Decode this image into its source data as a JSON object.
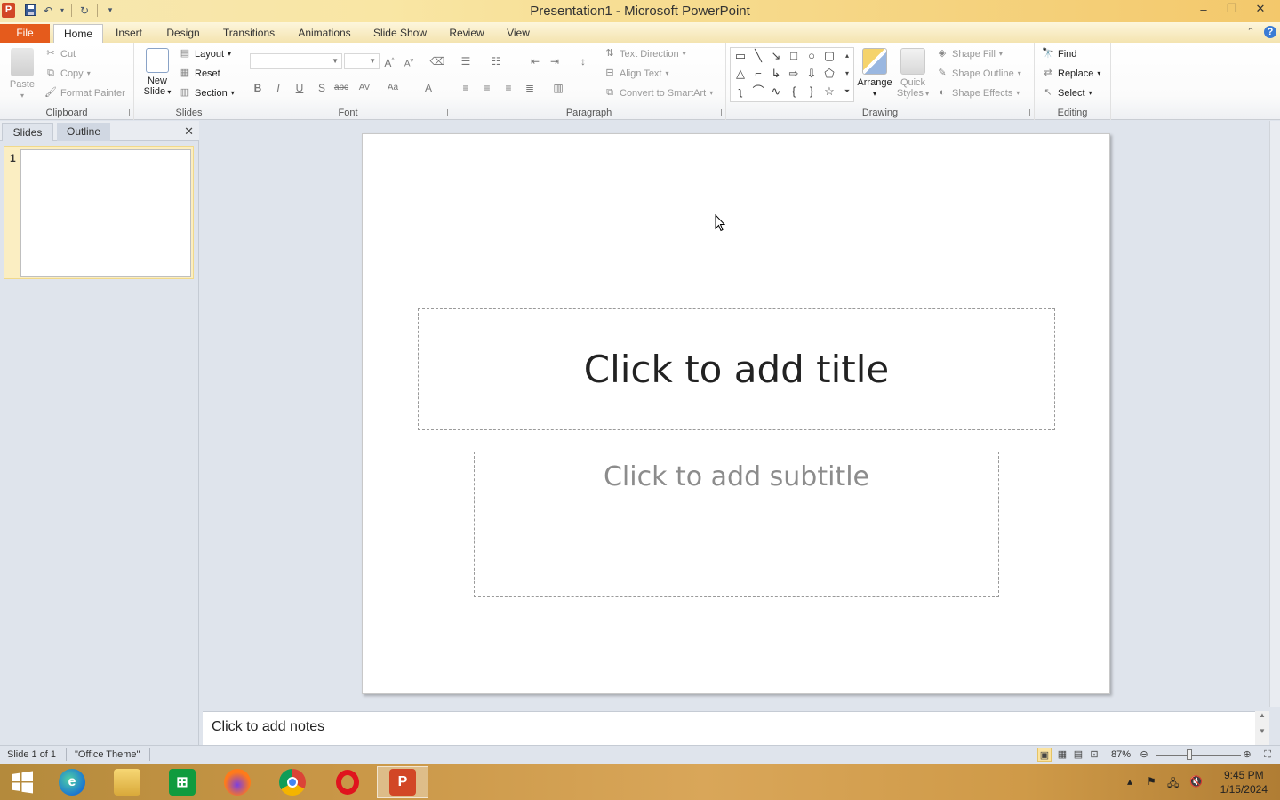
{
  "window": {
    "title": "Presentation1  -  Microsoft PowerPoint",
    "app_icon": "P"
  },
  "tabs": {
    "file": "File",
    "items": [
      "Home",
      "Insert",
      "Design",
      "Transitions",
      "Animations",
      "Slide Show",
      "Review",
      "View"
    ],
    "active": "Home"
  },
  "ribbon": {
    "clipboard": {
      "label": "Clipboard",
      "paste": "Paste",
      "cut": "Cut",
      "copy": "Copy",
      "format_painter": "Format Painter"
    },
    "slides": {
      "label": "Slides",
      "new_slide_line1": "New",
      "new_slide_line2": "Slide",
      "layout": "Layout",
      "reset": "Reset",
      "section": "Section"
    },
    "font": {
      "label": "Font"
    },
    "paragraph": {
      "label": "Paragraph",
      "text_direction": "Text Direction",
      "align_text": "Align Text",
      "convert_smartart": "Convert to SmartArt"
    },
    "drawing": {
      "label": "Drawing",
      "arrange": "Arrange",
      "quick_styles_line1": "Quick",
      "quick_styles_line2": "Styles",
      "shape_fill": "Shape Fill",
      "shape_outline": "Shape Outline",
      "shape_effects": "Shape Effects"
    },
    "editing": {
      "label": "Editing",
      "find": "Find",
      "replace": "Replace",
      "select": "Select"
    }
  },
  "left_pane": {
    "tab_slides": "Slides",
    "tab_outline": "Outline",
    "slide_number": "1"
  },
  "slide": {
    "title_placeholder": "Click to add title",
    "subtitle_placeholder": "Click to add subtitle"
  },
  "notes": {
    "placeholder": "Click to add notes"
  },
  "status": {
    "slide_info": "Slide 1 of 1",
    "theme": "\"Office Theme\"",
    "zoom": "87%"
  },
  "taskbar": {
    "time": "9:45 PM",
    "date": "1/15/2024"
  }
}
